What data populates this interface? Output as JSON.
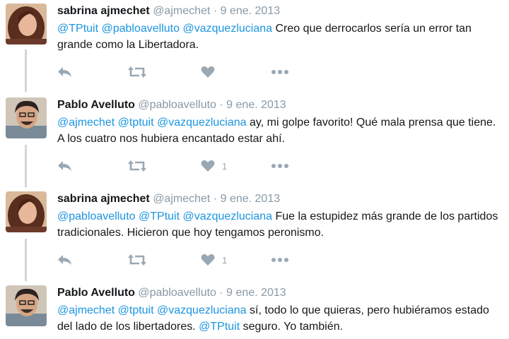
{
  "tweets": [
    {
      "name": "sabrina ajmechet",
      "handle": "@ajmechet",
      "sep": "·",
      "date": "9 ene. 2013",
      "mentions": [
        "@TPtuit",
        "@pabloavelluto",
        "@vazquezluciana"
      ],
      "text_rest": "Creo que derrocarlos sería un error tan grande como la Libertadora.",
      "like_count": ""
    },
    {
      "name": "Pablo Avelluto",
      "handle": "@pabloavelluto",
      "sep": "·",
      "date": "9 ene. 2013",
      "mentions": [
        "@ajmechet",
        "@tptuit",
        "@vazquezluciana"
      ],
      "text_rest": "ay, mi golpe favorito! Qué mala prensa que tiene. A los cuatro nos hubiera encantado estar ahí.",
      "like_count": "1"
    },
    {
      "name": "sabrina ajmechet",
      "handle": "@ajmechet",
      "sep": "·",
      "date": "9 ene. 2013",
      "mentions": [
        "@pabloavelluto",
        "@TPtuit",
        "@vazquezluciana"
      ],
      "text_rest": "Fue la estupidez más grande de los partidos tradicionales. Hicieron que hoy tengamos peronismo.",
      "like_count": "1"
    },
    {
      "name": "Pablo Avelluto",
      "handle": "@pabloavelluto",
      "sep": "·",
      "date": "9 ene. 2013",
      "mentions": [
        "@ajmechet",
        "@tptuit",
        "@vazquezluciana"
      ],
      "text_mid": "sí, todo lo que quieras, pero hubiéramos estado del lado de los libertadores.",
      "inline_mention": "@TPtuit",
      "text_end": "seguro. Yo también."
    }
  ],
  "colors": {
    "name": "#14171a",
    "meta": "#8899a6",
    "mention": "#1b95e0",
    "action": "#9aa8b4",
    "thread_line": "#cfd6dc"
  },
  "icons": [
    "reply-icon",
    "retweet-icon",
    "like-icon",
    "more-icon"
  ]
}
